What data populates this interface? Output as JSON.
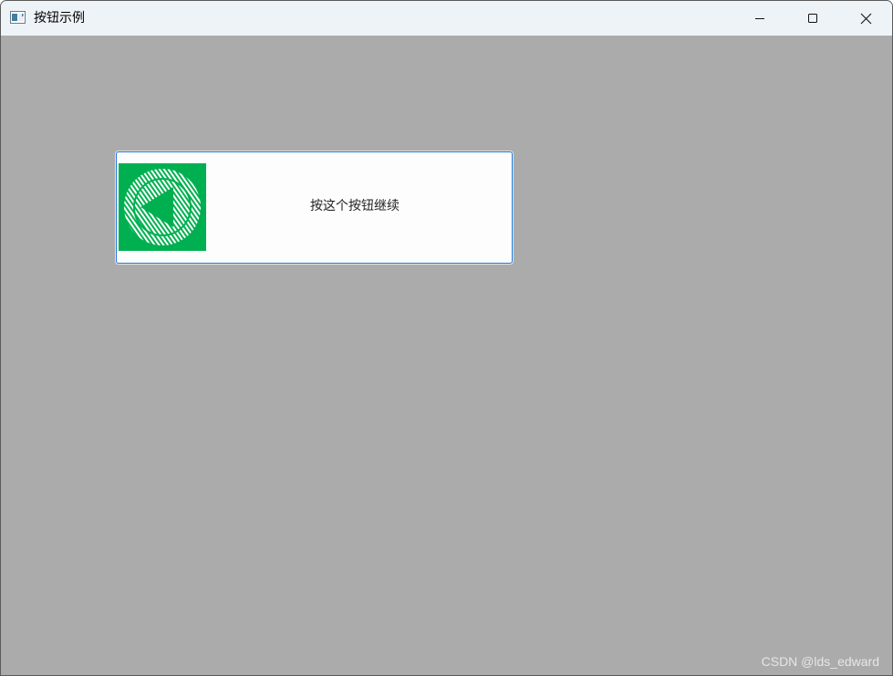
{
  "window": {
    "title": "按钮示例",
    "icon": "app-window-icon",
    "controls": {
      "minimize_icon": "minimize-icon",
      "maximize_icon": "maximize-icon",
      "close_icon": "close-icon"
    }
  },
  "main": {
    "image_button": {
      "label": "按这个按钮继续",
      "icon": "back-arrow-circle-icon",
      "icon_background": "#00b050"
    }
  },
  "watermark": "CSDN @lds_edward",
  "colors": {
    "client_background": "#ababab",
    "titlebar_background": "#eef3f8",
    "button_focus_border": "#1e78d4"
  }
}
